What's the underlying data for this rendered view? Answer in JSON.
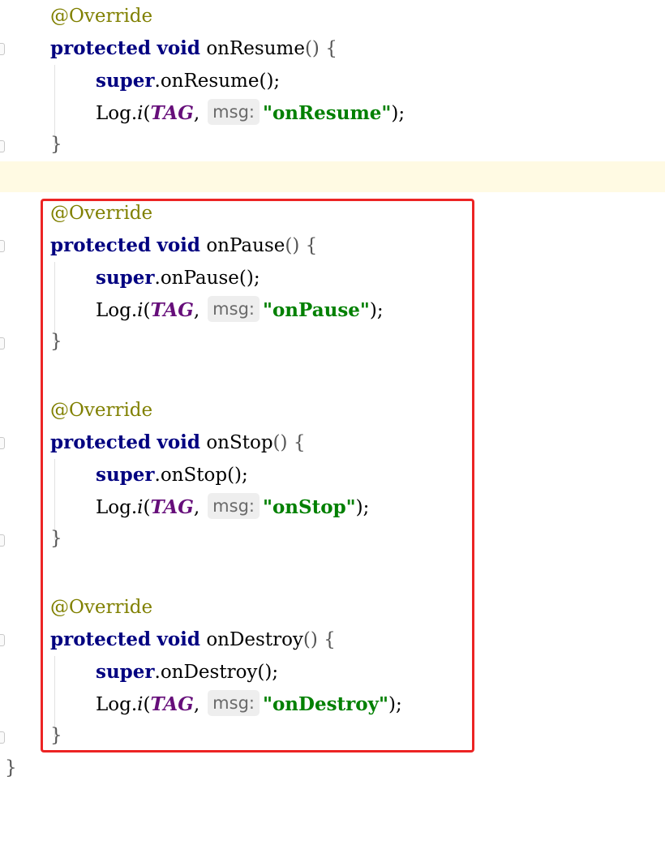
{
  "code": {
    "annotation": "@Override",
    "keywords": {
      "protected": "protected",
      "void": "void",
      "super": "super"
    },
    "log_class": "Log",
    "log_method": "i",
    "tag_constant": "TAG",
    "param_hint": "msg:",
    "methods": [
      {
        "name": "onResume",
        "message": "\"onResume\""
      },
      {
        "name": "onPause",
        "message": "\"onPause\""
      },
      {
        "name": "onStop",
        "message": "\"onStop\""
      },
      {
        "name": "onDestroy",
        "message": "\"onDestroy\""
      }
    ],
    "open_brace": "{",
    "close_brace": "}",
    "paren_open_close": "()",
    "call_end": "();",
    "stmt_end": ");",
    "dot": ".",
    "comma": ",",
    "paren_open": "("
  },
  "colors": {
    "keyword": "#000080",
    "annotation": "#808000",
    "string": "#008000",
    "constant": "#660e7a",
    "current_line": "#fffae3",
    "highlight_box": "#ec2424"
  }
}
